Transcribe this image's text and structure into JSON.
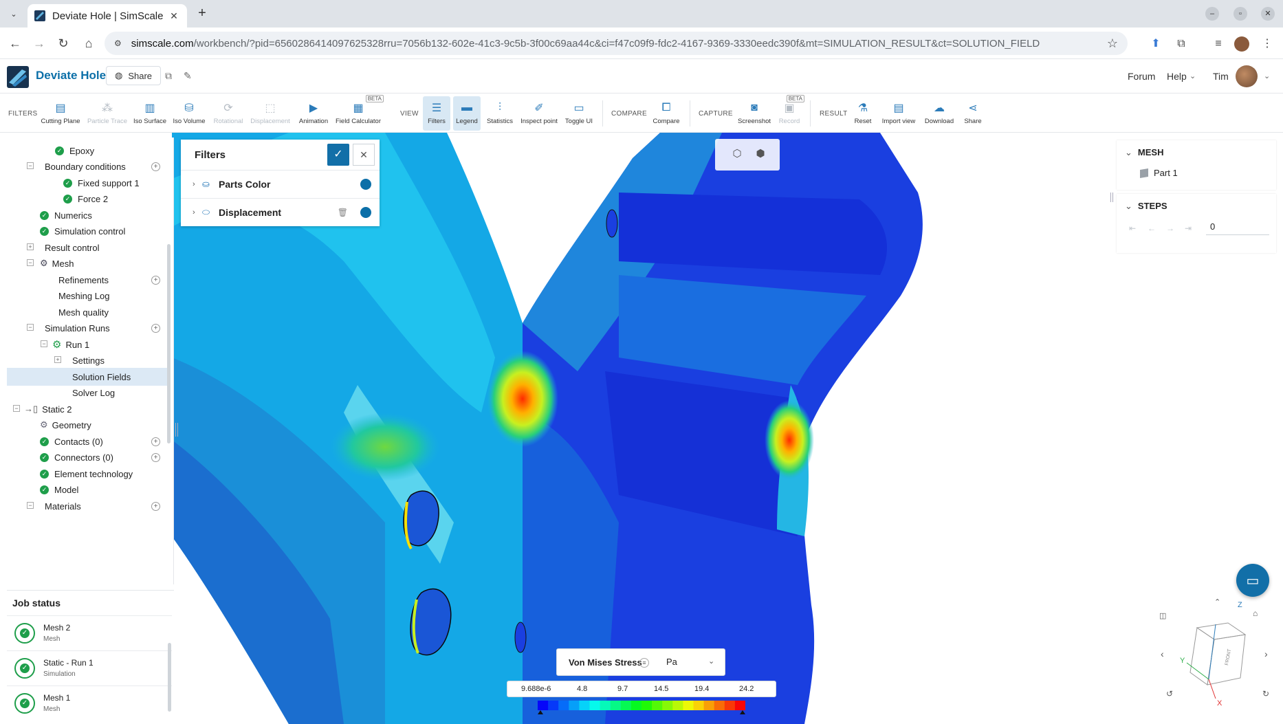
{
  "browser": {
    "tab_title": "Deviate Hole | SimScale",
    "new_tab": "+",
    "url_domain": "simscale.com",
    "url_path": "/workbench/?pid=6560286414097625328rru=7056b132-602e-41c3-9c5b-3f00c69aa44c&ci=f47c09f9-fdc2-4167-9369-3330eedc390f&mt=SIMULATION_RESULT&ct=SOLUTION_FIELD"
  },
  "app": {
    "project_title": "Deviate Hole",
    "share_label": "Share",
    "forum": "Forum",
    "help": "Help",
    "user": "Tim"
  },
  "toolbar": {
    "filters_group": "FILTERS",
    "view_group": "VIEW",
    "compare_group": "COMPARE",
    "capture_group": "CAPTURE",
    "result_group": "RESULT",
    "beta": "BETA",
    "items": {
      "cutting_plane": "Cutting Plane",
      "particle_trace": "Particle Trace",
      "iso_surface": "Iso Surface",
      "iso_volume": "Iso Volume",
      "rotational": "Rotational",
      "displacement": "Displacement",
      "animation": "Animation",
      "field_calculator": "Field Calculator",
      "filters": "Filters",
      "legend": "Legend",
      "statistics": "Statistics",
      "inspect_point": "Inspect point",
      "toggle_ui": "Toggle UI",
      "compare": "Compare",
      "screenshot": "Screenshot",
      "record": "Record",
      "reset": "Reset",
      "import_view": "Import view",
      "download": "Download",
      "share": "Share"
    }
  },
  "tree": {
    "epoxy": "Epoxy",
    "boundary_conditions": "Boundary conditions",
    "fixed_support": "Fixed support 1",
    "force": "Force 2",
    "numerics": "Numerics",
    "simulation_control": "Simulation control",
    "result_control": "Result control",
    "mesh": "Mesh",
    "refinements": "Refinements",
    "meshing_log": "Meshing Log",
    "mesh_quality": "Mesh quality",
    "simulation_runs": "Simulation Runs",
    "run1": "Run 1",
    "settings": "Settings",
    "solution_fields": "Solution Fields",
    "solver_log": "Solver Log",
    "static2": "Static 2",
    "geometry": "Geometry",
    "contacts": "Contacts (0)",
    "connectors": "Connectors (0)",
    "element_technology": "Element technology",
    "model": "Model",
    "materials": "Materials"
  },
  "job_status": {
    "title": "Job status",
    "items": [
      {
        "name": "Mesh 2",
        "type": "Mesh"
      },
      {
        "name": "Static - Run 1",
        "type": "Simulation"
      },
      {
        "name": "Mesh 1",
        "type": "Mesh"
      }
    ]
  },
  "filters_panel": {
    "title": "Filters",
    "rows": [
      {
        "label": "Parts Color"
      },
      {
        "label": "Displacement"
      }
    ]
  },
  "right_panel": {
    "mesh_title": "MESH",
    "part": "Part 1",
    "steps_title": "STEPS",
    "step_value": "0"
  },
  "legend": {
    "field": "Von Mises Stress",
    "unit": "Pa",
    "ticks": [
      "9.688e-6",
      "4.8",
      "9.7",
      "14.5",
      "19.4",
      "24.2"
    ]
  },
  "axes": {
    "z": "Z",
    "y": "Y",
    "x": "X",
    "front": "FRONT"
  },
  "colors": {
    "brand": "#0b6fa8",
    "success": "#1e9e4a"
  }
}
